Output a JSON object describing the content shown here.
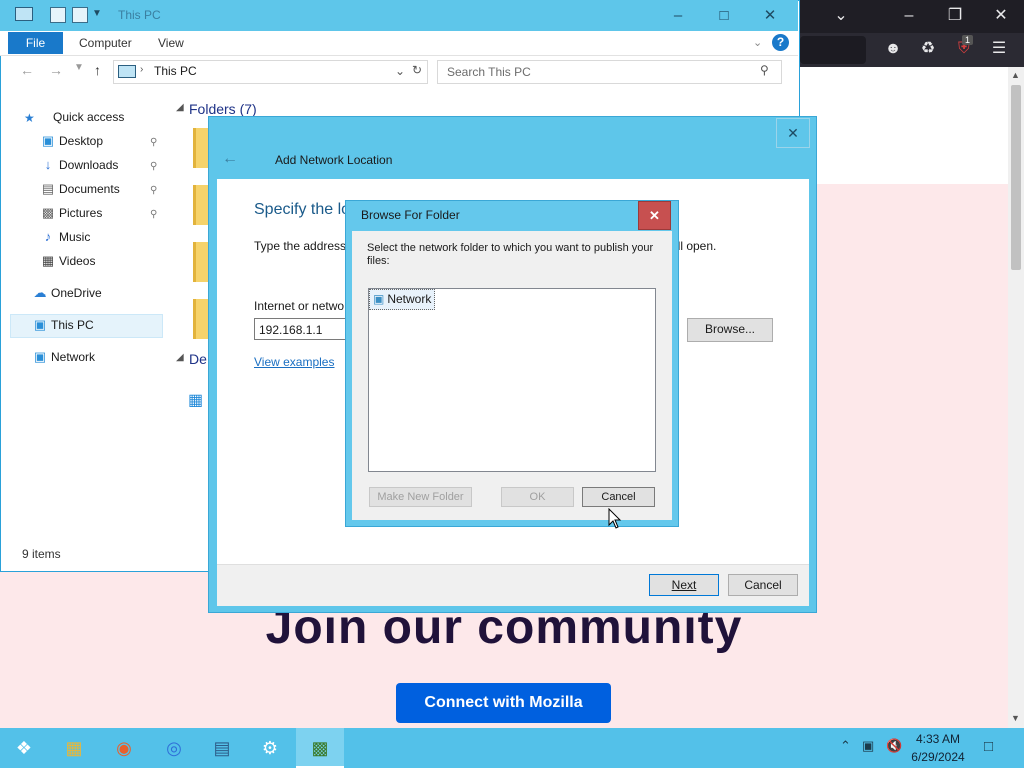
{
  "browser": {
    "heading": "Join our community",
    "cta": "Connect with Mozilla",
    "badge_count": "1"
  },
  "explorer": {
    "title": "This PC",
    "ribbon_tabs": [
      "File",
      "Computer",
      "View"
    ],
    "address": "This PC",
    "search_placeholder": "Search This PC",
    "section_folders": "Folders (7)",
    "section_devices": "De",
    "status": "9 items",
    "nav": {
      "quick_access": "Quick access",
      "desktop": "Desktop",
      "downloads": "Downloads",
      "documents": "Documents",
      "pictures": "Pictures",
      "music": "Music",
      "videos": "Videos",
      "onedrive": "OneDrive",
      "this_pc": "This PC",
      "network": "Network"
    }
  },
  "wizard": {
    "title": "Add Network Location",
    "heading": "Specify the lo",
    "desc_start": "Type the address",
    "desc_end": "ill open.",
    "address_label": "Internet or netwo",
    "address_value": "192.168.1.1",
    "browse": "Browse...",
    "examples": "View examples",
    "next": "Next",
    "cancel": "Cancel"
  },
  "browse_dialog": {
    "title": "Browse For Folder",
    "description": "Select the network folder to which you want to publish your files:",
    "tree_item": "Network",
    "new_folder": "Make New Folder",
    "ok": "OK",
    "cancel": "Cancel"
  },
  "taskbar": {
    "time": "4:33 AM",
    "date": "6/29/2024"
  },
  "colors": {
    "accent": "#0060df",
    "titlebar": "#5ec6ea",
    "taskbar": "#53c1e9",
    "close_red": "#c75050"
  }
}
